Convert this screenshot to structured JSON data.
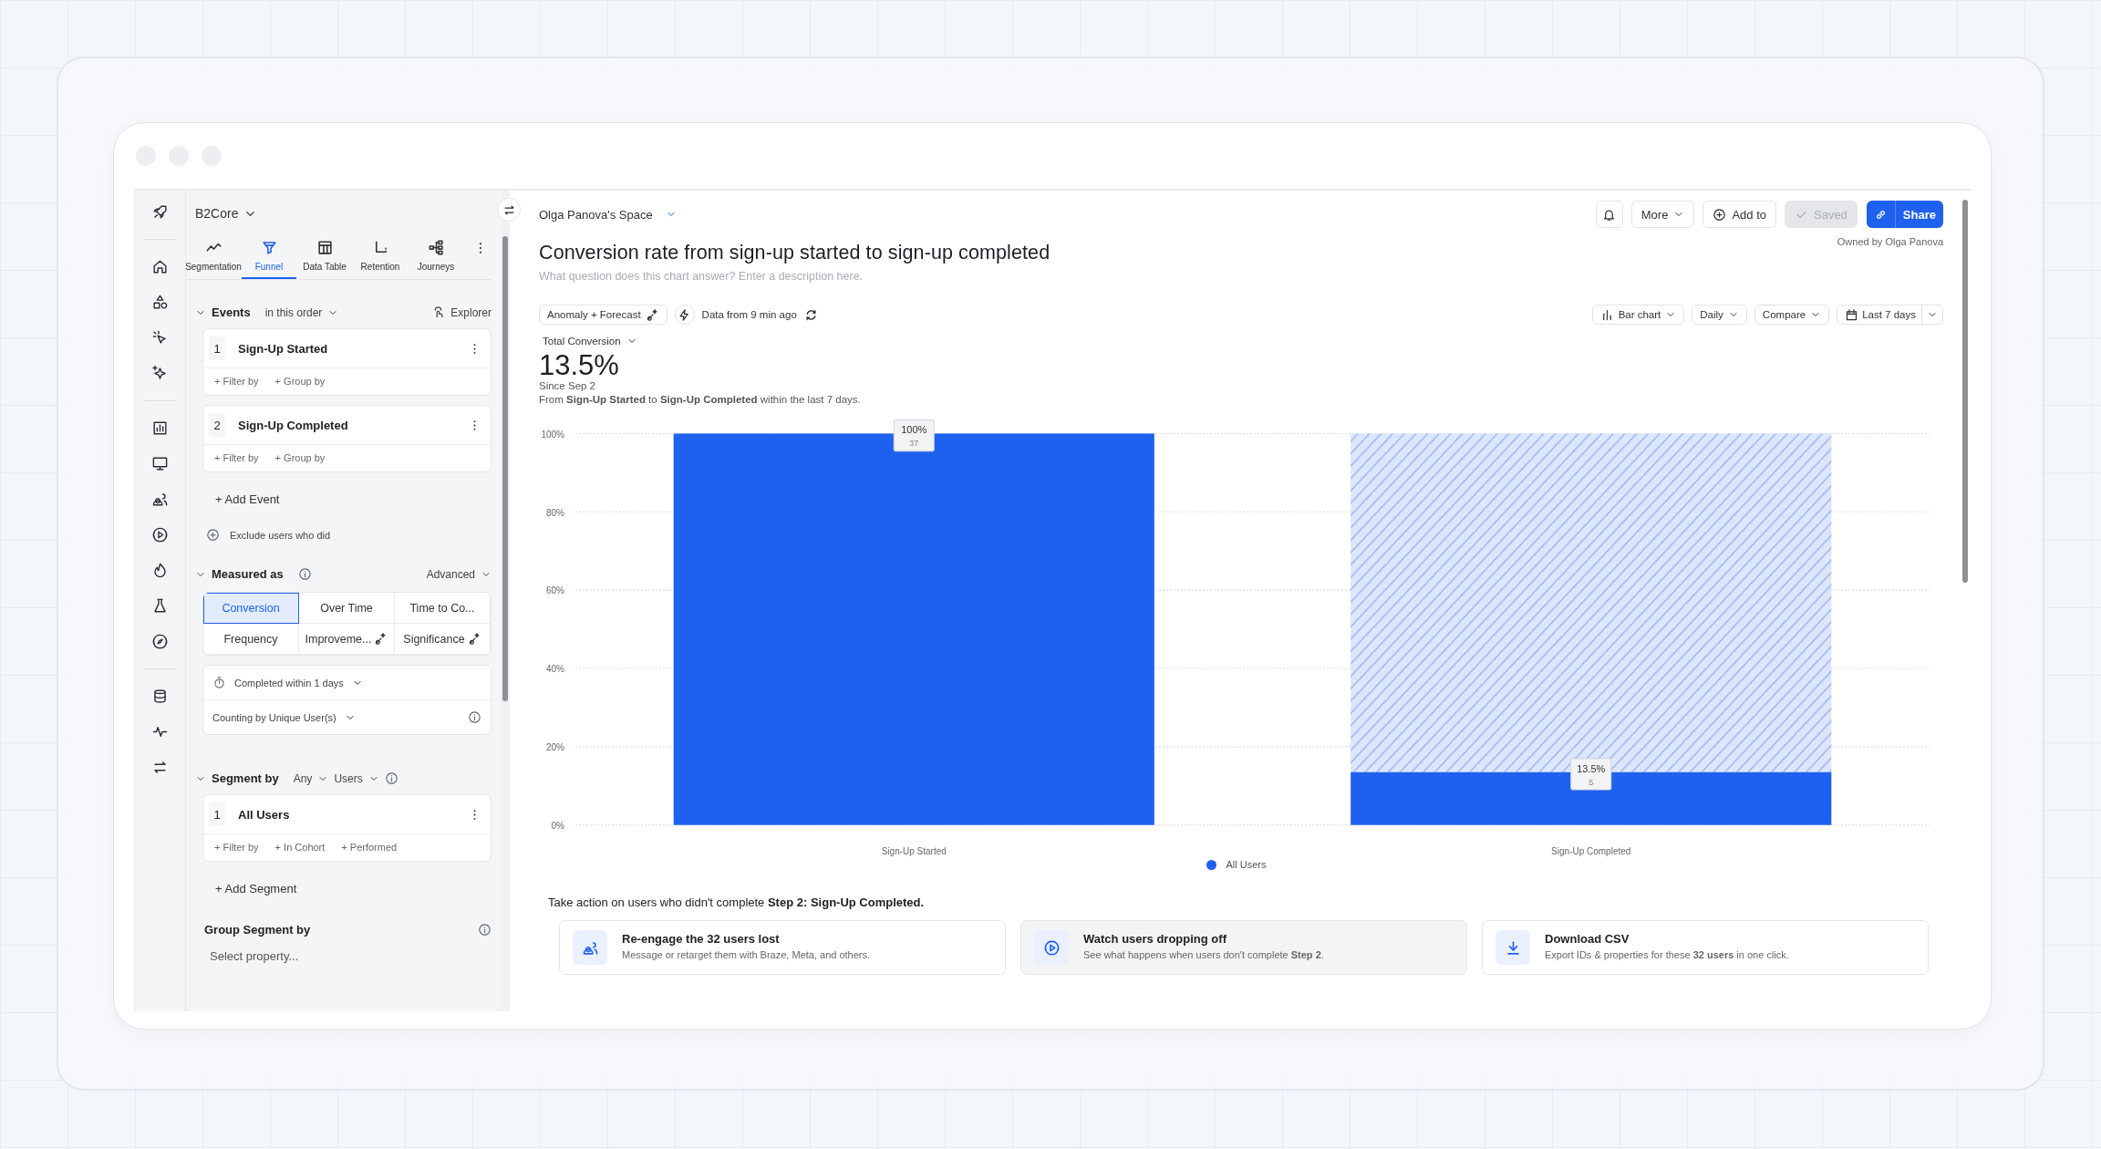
{
  "workspace": {
    "name": "B2Core"
  },
  "tabs": [
    {
      "label": "Segmentation",
      "kind": "segmentation",
      "selected": false
    },
    {
      "label": "Funnel",
      "kind": "funnel",
      "selected": true
    },
    {
      "label": "Data Table",
      "kind": "table",
      "selected": false
    },
    {
      "label": "Retention",
      "kind": "retention",
      "selected": false
    },
    {
      "label": "Journeys",
      "kind": "journeys",
      "selected": false
    }
  ],
  "events_section": {
    "title": "Events",
    "order": "in this order",
    "explorer": "Explorer"
  },
  "events": [
    {
      "index": "1",
      "name": "Sign-Up Started",
      "actions": [
        "+ Filter by",
        "+ Group by"
      ]
    },
    {
      "index": "2",
      "name": "Sign-Up Completed",
      "actions": [
        "+ Filter by",
        "+ Group by"
      ]
    }
  ],
  "add_event": "+ Add Event",
  "exclude": "Exclude users who did",
  "measured": {
    "title": "Measured as",
    "advanced": "Advanced",
    "options": [
      {
        "label": "Conversion",
        "selected": true,
        "badge": false
      },
      {
        "label": "Over Time",
        "selected": false,
        "badge": false
      },
      {
        "label": "Time to Co...",
        "selected": false,
        "badge": false
      },
      {
        "label": "Frequency",
        "selected": false,
        "badge": false
      },
      {
        "label": "Improveme...",
        "selected": false,
        "badge": true
      },
      {
        "label": "Significance",
        "selected": false,
        "badge": true
      }
    ],
    "completed_within": "Completed within 1 days",
    "counting": "Counting by Unique User(s)"
  },
  "segment": {
    "title": "Segment by",
    "any": "Any",
    "users": "Users",
    "segments": [
      {
        "index": "1",
        "name": "All Users",
        "actions": [
          "+ Filter by",
          "+ In Cohort",
          "+ Performed"
        ]
      }
    ],
    "add": "+ Add Segment"
  },
  "group_segment": {
    "title": "Group Segment by",
    "placeholder": "Select property..."
  },
  "header": {
    "space": "Olga Panova's Space",
    "more": "More",
    "add_to": "Add to",
    "saved": {
      "label": "Saved",
      "disabled": true
    },
    "share": "Share",
    "owner": "Owned by Olga Panova"
  },
  "chart_title": "Conversion rate from sign-up started to sign-up completed",
  "description": {
    "placeholder": "What question does this chart answer? Enter a description here."
  },
  "toolbar": {
    "anomaly": "Anomaly + Forecast",
    "data_age": "Data from 9 min ago",
    "chart_type": "Bar chart",
    "interval": "Daily",
    "compare": "Compare",
    "range": "Last 7 days"
  },
  "summary": {
    "metric": "Total Conversion",
    "value": "13.5%",
    "since": "Since Sep 2",
    "sentence": "From **Sign-Up Started** to **Sign-Up Completed** within the last 7 days."
  },
  "chart_data": {
    "type": "bar",
    "categories": [
      "Sign-Up Started",
      "Sign-Up Completed"
    ],
    "series": [
      {
        "name": "All Users",
        "color": "#1f61ef",
        "values": [
          100,
          13.5
        ]
      }
    ],
    "ylim": [
      0,
      100
    ],
    "yticks": [
      {
        "value": 0,
        "label": "0%"
      },
      {
        "value": 20,
        "label": "20%"
      },
      {
        "value": 40,
        "label": "40%"
      },
      {
        "value": 60,
        "label": "60%"
      },
      {
        "value": 80,
        "label": "80%"
      },
      {
        "value": 100,
        "label": "100%"
      }
    ],
    "grid": true,
    "value_labels": [
      "100%",
      "13.5%"
    ],
    "annotations": [
      "37",
      "5"
    ]
  },
  "actions": {
    "intro": "Take action on users who didn't complete **Step 2: Sign-Up Completed.**",
    "cards": [
      {
        "kind": "users",
        "title": "Re-engage the 32 users lost",
        "text": "Message or retarget them with Braze, Meta, and others.",
        "highlighted": false
      },
      {
        "kind": "play",
        "title": "Watch users dropping off",
        "text": "See what happens when users don't complete **Step 2**.",
        "highlighted": true
      },
      {
        "kind": "download",
        "title": "Download CSV",
        "text": "Export IDs & properties for these **32 users** in one click.",
        "highlighted": false
      }
    ]
  }
}
